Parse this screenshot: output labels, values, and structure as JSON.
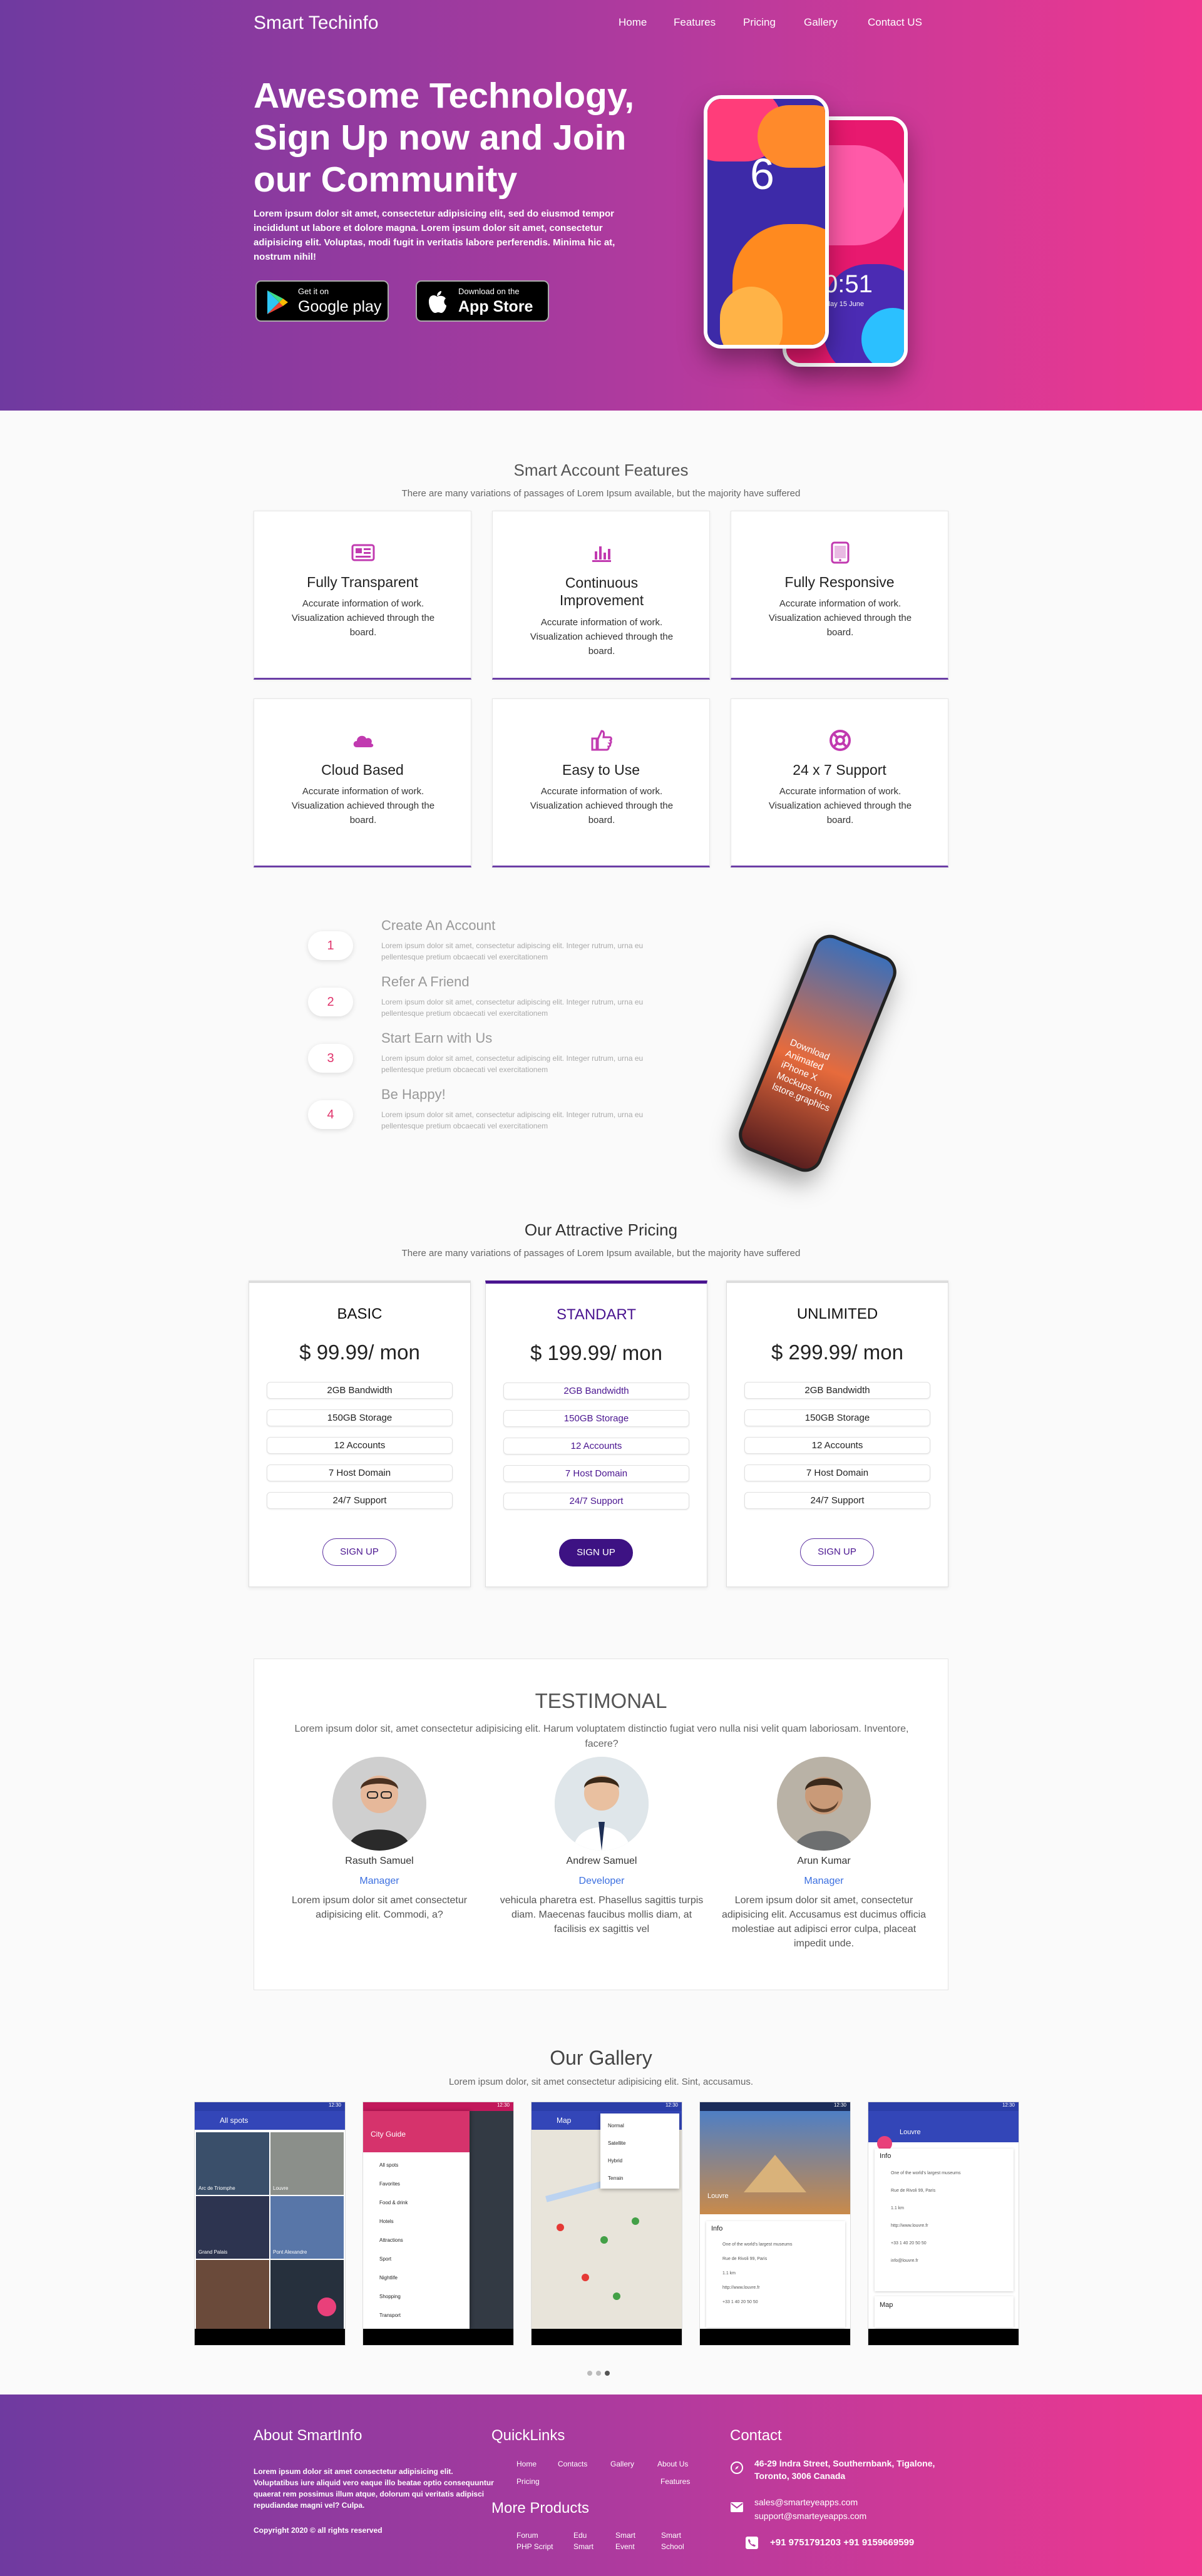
{
  "nav": {
    "brand": "Smart Techinfo",
    "links": [
      "Home",
      "Features",
      "Pricing",
      "Gallery",
      "Contact US"
    ]
  },
  "hero": {
    "title": "Awesome Technology, Sign Up now and Join our Community",
    "text": "Lorem ipsum dolor sit amet, consectetur adipisicing elit, sed do eiusmod tempor incididunt ut labore et dolore magna. Lorem ipsum dolor sit amet, consectetur adipisicing elit. Voluptas, modi fugit in veritatis labore perferendis. Minima hic at, nostrum nihil!",
    "google_small": "Get it on",
    "google_big": "Google play",
    "apple_small": "Download on the",
    "apple_big": "App Store",
    "phone_front_digit": "6",
    "phone_back_time": "0:51",
    "phone_back_date": "day 15 June"
  },
  "features": {
    "title": "Smart Account Features",
    "subtitle": "There are many variations of passages of Lorem Ipsum available, but the majority have suffered",
    "cards": [
      {
        "title": "Fully Transparent",
        "text": "Accurate information of work. Visualization achieved through the board.",
        "icon": "newspaper-icon"
      },
      {
        "title": "Continuous Improvement",
        "text": "Accurate information of work. Visualization achieved through the board.",
        "icon": "bar-chart-icon"
      },
      {
        "title": "Fully Responsive",
        "text": "Accurate information of work. Visualization achieved through the board.",
        "icon": "tablet-icon"
      },
      {
        "title": "Cloud Based",
        "text": "Accurate information of work. Visualization achieved through the board.",
        "icon": "cloud-icon"
      },
      {
        "title": "Easy to Use",
        "text": "Accurate information of work. Visualization achieved through the board.",
        "icon": "thumbs-up-icon"
      },
      {
        "title": "24 x 7 Support",
        "text": "Accurate information of work. Visualization achieved through the board.",
        "icon": "lifebuoy-icon"
      }
    ],
    "accent_color": "#c13ab0"
  },
  "steps": {
    "items": [
      {
        "num": "1",
        "title": "Create An Account",
        "text": "Lorem ipsum dolor sit amet, consectetur adipiscing elit. Integer rutrum, urna eu pellentesque pretium obcaecati vel exercitationem"
      },
      {
        "num": "2",
        "title": "Refer A Friend",
        "text": "Lorem ipsum dolor sit amet, consectetur adipiscing elit. Integer rutrum, urna eu pellentesque pretium obcaecati vel exercitationem"
      },
      {
        "num": "3",
        "title": "Start Earn with Us",
        "text": "Lorem ipsum dolor sit amet, consectetur adipiscing elit. Integer rutrum, urna eu pellentesque pretium obcaecati vel exercitationem"
      },
      {
        "num": "4",
        "title": "Be Happy!",
        "text": "Lorem ipsum dolor sit amet, consectetur adipiscing elit. Integer rutrum, urna eu pellentesque pretium obcaecati vel exercitationem"
      }
    ],
    "phone_screen_text": "Download Animated iPhone X Mockups from lstore.graphics"
  },
  "pricing": {
    "title": "Our Attractive Pricing",
    "subtitle": "There are many variations of passages of Lorem Ipsum available, but the majority have suffered",
    "plans": [
      {
        "name": "BASIC",
        "price": "$ 99.99/ mon",
        "features": [
          "2GB Bandwidth",
          "150GB Storage",
          "12 Accounts",
          "7 Host Domain",
          "24/7 Support"
        ],
        "button": "SIGN UP"
      },
      {
        "name": "STANDART",
        "price": "$ 199.99/ mon",
        "features": [
          "2GB Bandwidth",
          "150GB Storage",
          "12 Accounts",
          "7 Host Domain",
          "24/7 Support"
        ],
        "button": "SIGN UP"
      },
      {
        "name": "UNLIMITED",
        "price": "$ 299.99/ mon",
        "features": [
          "2GB Bandwidth",
          "150GB Storage",
          "12 Accounts",
          "7 Host Domain",
          "24/7 Support"
        ],
        "button": "SIGN UP"
      }
    ]
  },
  "testimonial": {
    "title": "TESTIMONAL",
    "subtitle": "Lorem ipsum dolor sit, amet consectetur adipisicing elit. Harum voluptatem distinctio fugiat vero nulla nisi velit quam laboriosam. Inventore, facere?",
    "people": [
      {
        "name": "Rasuth Samuel",
        "role": "Manager",
        "text": "Lorem ipsum dolor sit amet consectetur adipisicing elit. Commodi, a?"
      },
      {
        "name": "Andrew Samuel",
        "role": "Developer",
        "text": "vehicula pharetra est. Phasellus sagittis turpis diam. Maecenas faucibus mollis diam, at facilisis ex sagittis vel"
      },
      {
        "name": "Arun Kumar",
        "role": "Manager",
        "text": "Lorem ipsum dolor sit amet, consectetur adipisicing elit. Accusamus est ducimus officia molestiae aut adipisci error culpa, placeat impedit unde."
      }
    ]
  },
  "gallery": {
    "title": "Our Gallery",
    "subtitle": "Lorem ipsum dolor, sit amet consectetur adipisicing elit. Sint, accusamus.",
    "shot1": {
      "appbar": "All spots",
      "status": "12:30",
      "tiles": [
        "Arc de Triomphe",
        "Louvre",
        "Grand Palais",
        "Pont Alexandre"
      ]
    },
    "shot2": {
      "header": "City Guide",
      "status": "12:30",
      "menu": [
        "All spots",
        "Favorites",
        "Food & drink",
        "Hotels",
        "Attractions",
        "Sport",
        "Nightlife",
        "Shopping",
        "Transport"
      ]
    },
    "shot3": {
      "appbar": "Map",
      "status": "12:30",
      "menu": [
        "Normal",
        "Satellite",
        "Hybrid",
        "Terrain"
      ]
    },
    "shot4": {
      "place": "Louvre",
      "status": "12:30",
      "section": "Info",
      "rows": [
        "One of the world's largest museums",
        "Rue de Rivoli 99, Paris",
        "1.1 km",
        "http://www.louvre.fr",
        "+33 1 40 20 50 50"
      ]
    },
    "shot5": {
      "appbar": "Louvre",
      "status": "12:30",
      "section": "Info",
      "rows": [
        "One of the world's largest museums",
        "Rue de Rivoli 99, Paris",
        "1.1 km",
        "http://www.louvre.fr",
        "+33 1 40 20 50 50",
        "info@louvre.fr"
      ],
      "map_label": "Map"
    },
    "active_dot": 2
  },
  "footer": {
    "about_title": "About SmartInfo",
    "about_text": "Lorem ipsum dolor sit amet consectetur adipisicing elit. Voluptatibus iure aliquid vero eaque illo beatae optio consequuntur quaerat rem possimus illum atque, dolorum qui veritatis adipisci repudiandae magni vel? Culpa.",
    "copyright": "Copyright 2020 © all rights reserved",
    "quick_title": "QuickLinks",
    "quick_links": [
      "Home",
      "Contacts",
      "Gallery",
      "About Us",
      "Pricing",
      "Features"
    ],
    "more_title": "More Products",
    "products": [
      "Forum",
      "Edu",
      "Smart",
      "Smart",
      "PHP Script",
      "Smart",
      "Event",
      "School"
    ],
    "contact_title": "Contact",
    "address": "46-29 Indra Street, Southernbank, Tigalone, Toronto, 3006 Canada",
    "email1": "sales@smarteyeapps.com",
    "email2": "support@smarteyeapps.com",
    "phone": "+91 9751791203 +91 9159669599"
  }
}
